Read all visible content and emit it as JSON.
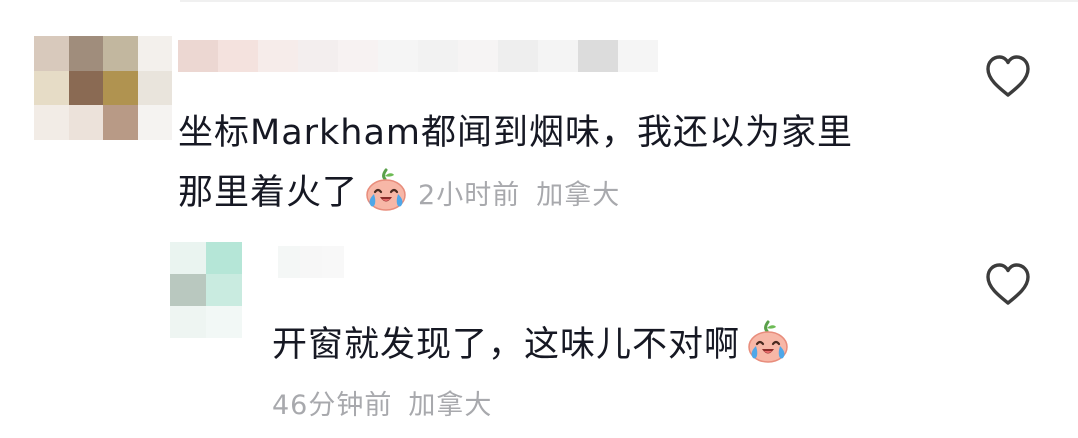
{
  "comments": [
    {
      "author_hidden": true,
      "text_line1": "坐标Markham都闻到烟味，我还以为家里",
      "text_line2": "那里着火了",
      "emoji": "crying-laughing-face-icon",
      "time": "2小时前",
      "location": "加拿大",
      "like_icon": "heart-outline-icon",
      "avatar_colors": [
        "#d8c9bc",
        "#a08d7c",
        "#c2b79f",
        "#f3f0ec",
        "#e6dcc6",
        "#8a6a53",
        "#b09350",
        "#e9e4dc",
        "#f2ece6",
        "#ece2da",
        "#b89a86",
        "#f5f3f1"
      ],
      "name_blur_colors": [
        "#ecd7d2",
        "#f4e2de",
        "#f6ecea",
        "#f3eeee",
        "#f7f2f2",
        "#f5f5f5",
        "#f2f2f2",
        "#f6f4f4",
        "#eeeeee",
        "#f4f4f4",
        "#dcdcdc",
        "#f5f5f5"
      ]
    },
    {
      "author_hidden": true,
      "text_line1": "开窗就发现了，这味儿不对啊",
      "emoji": "crying-laughing-face-icon",
      "time": "46分钟前",
      "location": "加拿大",
      "like_icon": "heart-outline-icon",
      "avatar_colors": [
        "#eaf4f0",
        "#b5e6d7",
        "#ffffff",
        "#b9c8bf",
        "#c9ebe0",
        "#ffffff",
        "#eef5f2",
        "#f2f8f6",
        "#ffffff"
      ],
      "name_blur_colors": [
        "#f4f7f6",
        "#f7f7f7",
        "#f8f8f8"
      ]
    }
  ],
  "colors": {
    "text": "#161823",
    "meta": "#a8a9ad",
    "icon_stroke": "#3c3c3c"
  }
}
